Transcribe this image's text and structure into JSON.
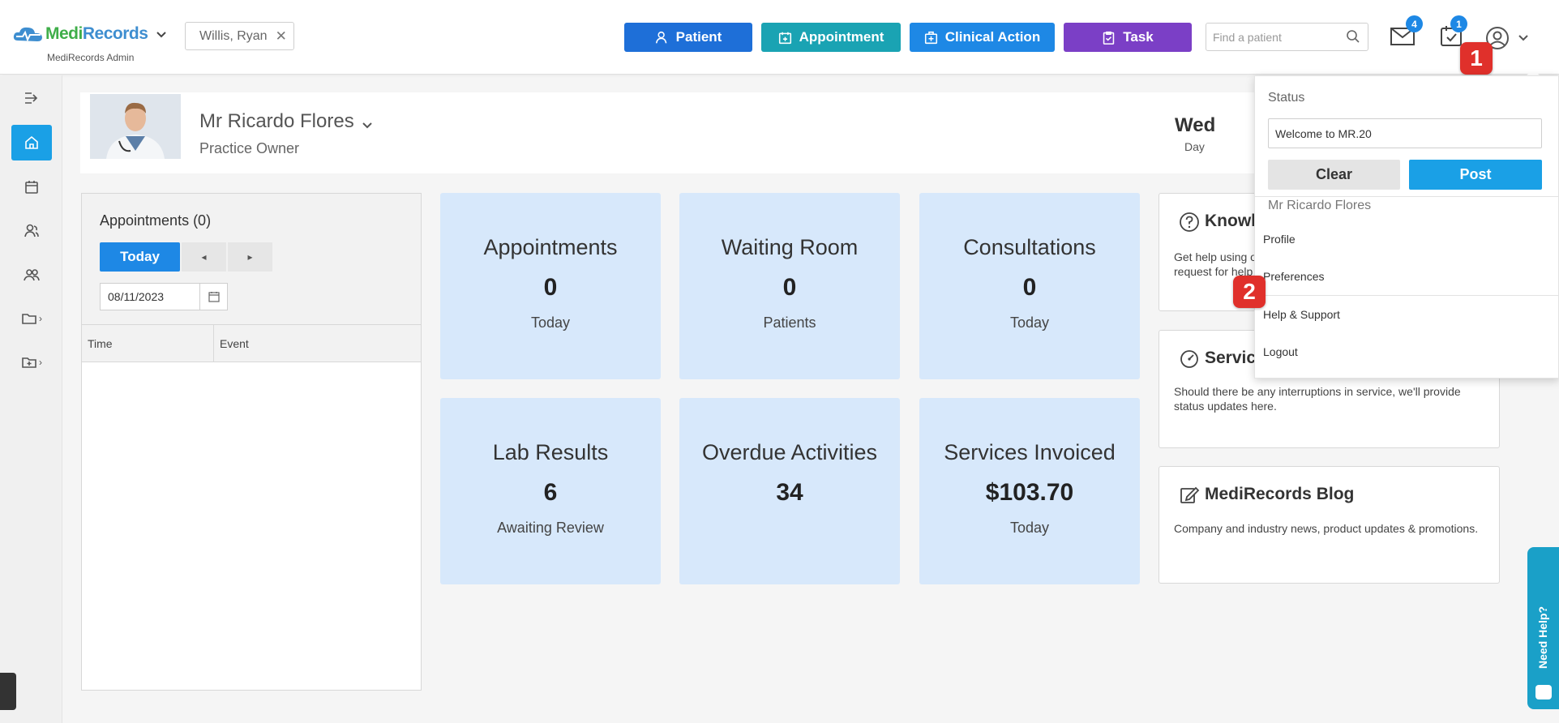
{
  "header": {
    "logo": {
      "brand_part1": "Medi",
      "brand_part2": "Records",
      "subtitle": "MediRecords Admin"
    },
    "current_patient": "Willis, Ryan",
    "actions": {
      "patient": "Patient",
      "appointment": "Appointment",
      "clinical_action": "Clinical Action",
      "task": "Task"
    },
    "search_placeholder": "Find a patient",
    "mail_count": "4",
    "task_count": "1"
  },
  "callouts": {
    "one": "1",
    "two": "2"
  },
  "profile": {
    "name": "Mr Ricardo Flores",
    "role": "Practice Owner",
    "day_short": "Wed",
    "day_label": "Day"
  },
  "appointments": {
    "title": "Appointments (0)",
    "today_label": "Today",
    "prev_label": "◂",
    "next_label": "▸",
    "date": "08/11/2023",
    "columns": [
      "Time",
      "Event"
    ]
  },
  "tiles": [
    {
      "title": "Appointments",
      "value": "0",
      "sub": "Today"
    },
    {
      "title": "Waiting Room",
      "value": "0",
      "sub": "Patients"
    },
    {
      "title": "Consultations",
      "value": "0",
      "sub": "Today"
    },
    {
      "title": "Lab Results",
      "value": "6",
      "sub": "Awaiting Review"
    },
    {
      "title": "Overdue Activities",
      "value": "34",
      "sub": ""
    },
    {
      "title": "Services Invoiced",
      "value": "$103.70",
      "sub": "Today"
    }
  ],
  "info_cards": {
    "knowledge": {
      "title": "Knowl",
      "body": "Get help using o request for help"
    },
    "service": {
      "title": "Servic",
      "body": "Should there be any interruptions in service, we'll provide status updates here."
    },
    "blog": {
      "title": "MediRecords Blog",
      "body": "Company and industry news, product updates & promotions."
    }
  },
  "dropdown": {
    "status_label": "Status",
    "status_value": "Welcome to MR.20",
    "clear": "Clear",
    "post": "Post",
    "user_name": "Mr Ricardo Flores",
    "items": [
      "Profile",
      "Preferences",
      "Help & Support",
      "Logout"
    ]
  },
  "need_help": "Need Help?",
  "colors": {
    "patient_btn": "#1e6fd8",
    "appointment_btn": "#1aa3b3",
    "clinical_btn": "#1e88e5",
    "task_btn": "#7b3fc6",
    "tile_bg": "#d7e8fb",
    "callout": "#e0302b"
  }
}
